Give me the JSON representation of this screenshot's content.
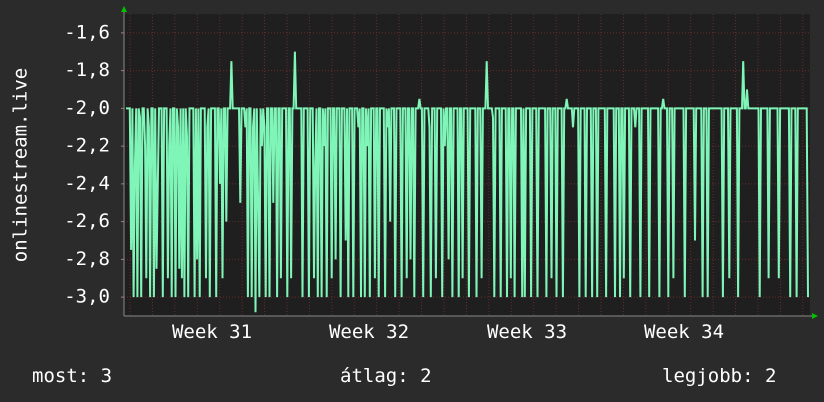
{
  "chart_data": {
    "type": "line",
    "ylabel": "onlinestream.live",
    "xlabel": "",
    "ylim": [
      -3.1,
      -1.5
    ],
    "yticks": [
      -1.6,
      -1.8,
      -2.0,
      -2.2,
      -2.4,
      -2.6,
      -2.8,
      -3.0
    ],
    "ytick_labels": [
      "-1,6",
      "-1,8",
      "-2,0",
      "-2,2",
      "-2,4",
      "-2,6",
      "-2,8",
      "-3,0"
    ],
    "xticks": [
      "Week 31",
      "Week 32",
      "Week 33",
      "Week 34"
    ],
    "grid": true,
    "colors": {
      "background": "#2b2b2b",
      "plot_area": "#1f1f1f",
      "line": "#7ff5b8",
      "grid": "#6b2b2b",
      "axis_arrow": "#00c000"
    },
    "series": [
      {
        "values": [
          -2.0,
          -2.0,
          -2.0,
          -2.0,
          -2.75,
          -2.0,
          -3.0,
          -2.3,
          -2.0,
          -3.0,
          -2.0,
          -2.05,
          -3.0,
          -2.0,
          -2.0,
          -2.2,
          -2.9,
          -2.0,
          -2.1,
          -3.0,
          -2.0,
          -2.0,
          -3.0,
          -2.0,
          -2.85,
          -2.4,
          -2.0,
          -2.0,
          -2.0,
          -3.0,
          -2.0,
          -2.0,
          -2.0,
          -2.9,
          -2.2,
          -2.0,
          -3.0,
          -2.0,
          -2.0,
          -3.0,
          -2.0,
          -2.1,
          -2.85,
          -2.0,
          -2.9,
          -2.0,
          -3.0,
          -2.0,
          -2.15,
          -3.0,
          -2.0,
          -2.0,
          -2.0,
          -2.0,
          -3.0,
          -2.0,
          -2.8,
          -2.0,
          -3.0,
          -2.0,
          -2.0,
          -2.0,
          -2.0,
          -2.9,
          -2.1,
          -2.0,
          -3.0,
          -2.0,
          -2.0,
          -2.0,
          -2.0,
          -3.0,
          -2.0,
          -2.0,
          -2.4,
          -2.0,
          -2.9,
          -2.0,
          -2.0,
          -2.6,
          -2.0,
          -2.0,
          -2.0,
          -1.75,
          -2.0,
          -2.0,
          -2.0,
          -2.0,
          -2.0,
          -2.0,
          -2.5,
          -2.0,
          -2.0,
          -2.0,
          -2.1,
          -2.0,
          -3.0,
          -2.0,
          -2.0,
          -3.0,
          -2.1,
          -2.0,
          -3.08,
          -2.0,
          -2.5,
          -3.0,
          -2.0,
          -2.2,
          -2.0,
          -2.1,
          -3.0,
          -2.0,
          -2.0,
          -3.0,
          -2.0,
          -2.0,
          -2.5,
          -2.0,
          -2.0,
          -3.0,
          -2.0,
          -2.0,
          -2.9,
          -2.0,
          -2.0,
          -2.0,
          -2.0,
          -3.0,
          -2.0,
          -2.0,
          -2.9,
          -2.0,
          -2.0,
          -1.7,
          -2.0,
          -2.0,
          -2.0,
          -2.0,
          -2.0,
          -3.0,
          -2.0,
          -2.0,
          -2.0,
          -2.0,
          -3.0,
          -2.0,
          -2.0,
          -2.0,
          -2.9,
          -2.3,
          -2.0,
          -3.0,
          -2.0,
          -2.0,
          -3.0,
          -2.0,
          -2.2,
          -2.0,
          -3.0,
          -2.0,
          -2.0,
          -2.0,
          -2.9,
          -2.0,
          -2.0,
          -2.8,
          -2.0,
          -2.0,
          -2.0,
          -3.0,
          -2.0,
          -2.0,
          -2.0,
          -2.7,
          -2.0,
          -3.0,
          -2.0,
          -2.0,
          -2.0,
          -3.0,
          -2.0,
          -2.0,
          -2.0,
          -2.1,
          -2.0,
          -3.0,
          -2.0,
          -2.0,
          -3.0,
          -2.0,
          -2.2,
          -2.0,
          -3.0,
          -2.0,
          -2.0,
          -2.0,
          -2.9,
          -2.0,
          -2.0,
          -3.0,
          -2.0,
          -2.0,
          -2.0,
          -2.0,
          -3.0,
          -2.0,
          -2.1,
          -2.0,
          -2.6,
          -2.0,
          -2.0,
          -2.0,
          -3.0,
          -2.0,
          -2.0,
          -2.0,
          -2.0,
          -3.0,
          -2.0,
          -2.0,
          -2.0,
          -2.9,
          -2.0,
          -2.0,
          -2.8,
          -2.0,
          -2.0,
          -3.0,
          -2.0,
          -2.0,
          -2.0,
          -1.95,
          -2.0,
          -2.0,
          -3.0,
          -2.0,
          -2.0,
          -2.0,
          -2.0,
          -2.1,
          -3.0,
          -2.0,
          -2.0,
          -2.0,
          -2.9,
          -2.0,
          -2.0,
          -2.0,
          -2.0,
          -3.0,
          -2.0,
          -2.2,
          -2.0,
          -2.0,
          -2.8,
          -2.0,
          -2.0,
          -3.0,
          -2.0,
          -2.0,
          -2.0,
          -2.0,
          -3.0,
          -2.0,
          -2.0,
          -2.9,
          -2.0,
          -2.0,
          -2.0,
          -2.0,
          -3.0,
          -2.0,
          -2.0,
          -2.0,
          -2.0,
          -2.0,
          -3.0,
          -2.0,
          -2.0,
          -2.0,
          -2.9,
          -2.0,
          -2.0,
          -2.0,
          -1.75,
          -2.0,
          -2.0,
          -2.0,
          -2.0,
          -2.05,
          -3.0,
          -2.0,
          -2.0,
          -2.0,
          -2.0,
          -3.0,
          -2.0,
          -2.0,
          -2.0,
          -2.0,
          -3.0,
          -2.0,
          -2.0,
          -2.9,
          -2.0,
          -2.0,
          -3.0,
          -2.0,
          -2.0,
          -2.0,
          -2.0,
          -2.0,
          -3.0,
          -2.0,
          -3.0,
          -2.0,
          -2.0,
          -2.0,
          -2.0,
          -3.0,
          -2.0,
          -2.0,
          -2.0,
          -2.0,
          -3.0,
          -2.0,
          -2.0,
          -2.0,
          -2.0,
          -2.0,
          -2.0,
          -3.0,
          -2.0,
          -2.0,
          -2.0,
          -2.9,
          -2.0,
          -2.0,
          -2.0,
          -3.0,
          -2.0,
          -2.0,
          -2.0,
          -2.0,
          -3.0,
          -2.0,
          -2.0,
          -1.95,
          -2.0,
          -2.0,
          -2.0,
          -2.0,
          -2.1,
          -2.0,
          -2.0,
          -2.0,
          -2.0,
          -3.0,
          -2.0,
          -2.0,
          -2.0,
          -2.0,
          -3.0,
          -2.0,
          -2.0,
          -2.0,
          -2.0,
          -3.0,
          -2.0,
          -2.0,
          -2.0,
          -3.0,
          -2.0,
          -2.0,
          -2.0,
          -2.0,
          -2.0,
          -2.0,
          -3.0,
          -2.0,
          -2.0,
          -2.0,
          -2.0,
          -2.0,
          -2.0,
          -3.0,
          -2.0,
          -2.0,
          -2.0,
          -3.0,
          -2.0,
          -2.0,
          -2.9,
          -2.0,
          -2.0,
          -2.0,
          -2.0,
          -3.0,
          -2.0,
          -2.0,
          -2.0,
          -2.1,
          -2.0,
          -2.0,
          -2.0,
          -3.0,
          -2.0,
          -2.0,
          -2.0,
          -2.0,
          -2.0,
          -2.0,
          -3.0,
          -2.0,
          -2.0,
          -2.0,
          -2.0,
          -2.0,
          -2.0,
          -2.0,
          -3.0,
          -2.0,
          -2.0,
          -1.95,
          -2.0,
          -2.0,
          -2.0,
          -3.0,
          -2.0,
          -2.0,
          -2.0,
          -2.9,
          -2.0,
          -2.0,
          -2.0,
          -2.0,
          -2.0,
          -2.0,
          -2.0,
          -2.0,
          -3.0,
          -2.0,
          -2.0,
          -2.0,
          -2.0,
          -2.0,
          -2.0,
          -2.0,
          -2.7,
          -2.0,
          -2.0,
          -2.0,
          -2.0,
          -2.0,
          -3.0,
          -2.0,
          -2.0,
          -2.0,
          -3.0,
          -2.0,
          -2.0,
          -2.0,
          -2.0,
          -2.0,
          -2.0,
          -2.0,
          -2.0,
          -2.0,
          -2.0,
          -2.0,
          -3.0,
          -2.0,
          -2.0,
          -2.0,
          -2.0,
          -2.9,
          -2.0,
          -2.0,
          -2.0,
          -2.0,
          -2.0,
          -2.0,
          -3.0,
          -2.0,
          -2.0,
          -2.0,
          -1.75,
          -2.0,
          -2.0,
          -1.9,
          -2.0,
          -2.0,
          -2.0,
          -2.0,
          -2.0,
          -2.0,
          -2.0,
          -2.0,
          -2.0,
          -3.0,
          -2.0,
          -2.0,
          -2.0,
          -2.0,
          -2.0,
          -2.0,
          -2.9,
          -2.0,
          -2.0,
          -2.0,
          -2.0,
          -2.0,
          -2.0,
          -2.0,
          -2.9,
          -2.0,
          -2.0,
          -2.0,
          -2.0,
          -2.0,
          -2.0,
          -2.0,
          -2.0,
          -3.0,
          -2.0,
          -2.0,
          -2.0,
          -2.0,
          -3.0,
          -2.0,
          -2.0,
          -2.0,
          -2.0,
          -2.0,
          -2.0,
          -2.0,
          -2.0,
          -3.0
        ]
      }
    ]
  },
  "footer": {
    "current": "most: 3",
    "average": "átlag: 2",
    "best": "legjobb: 2"
  }
}
